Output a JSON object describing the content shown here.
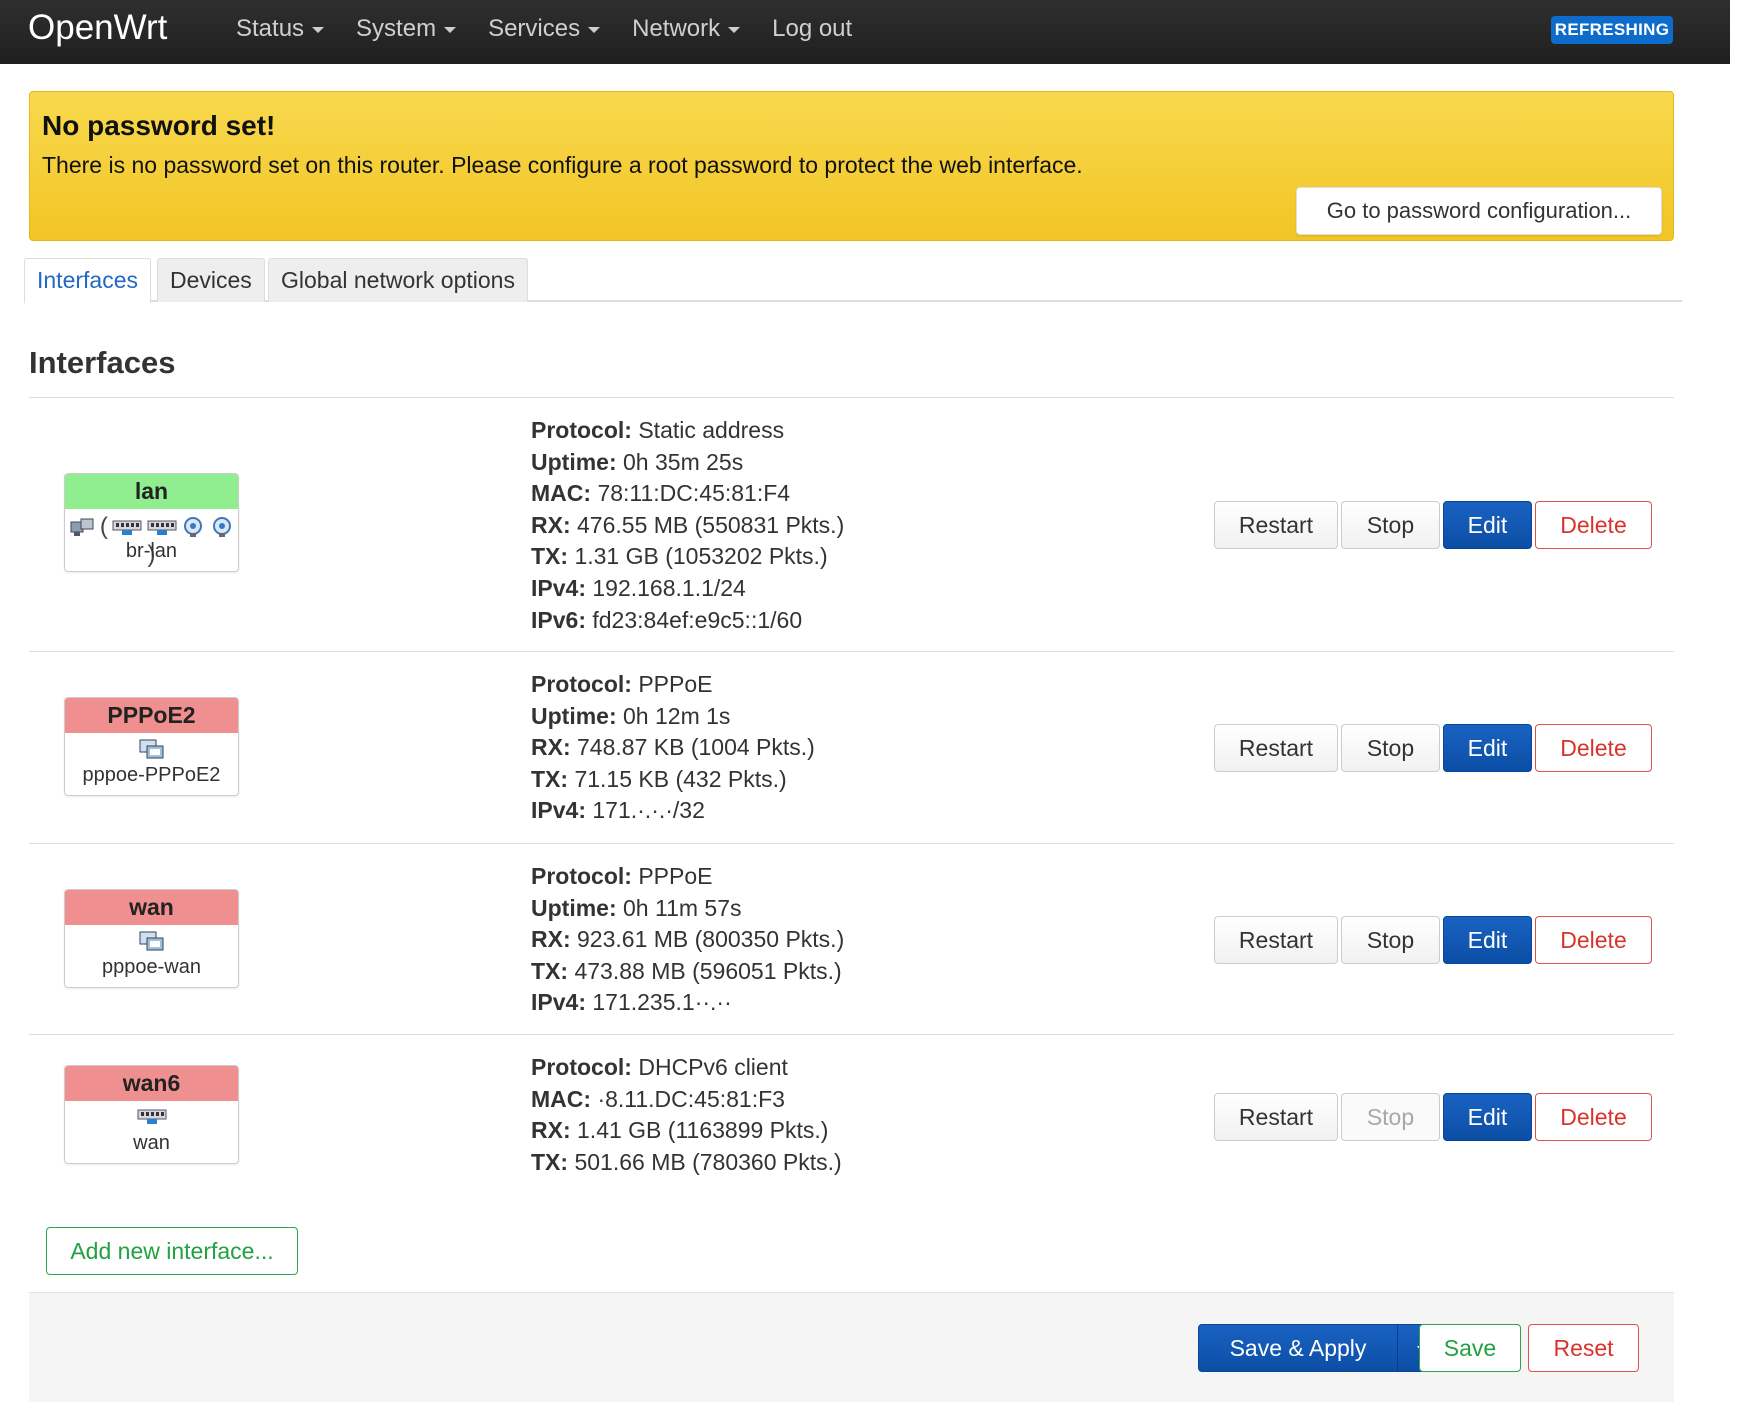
{
  "app": {
    "brand": "OpenWrt",
    "status_badge": "REFRESHING"
  },
  "nav": {
    "items": [
      {
        "label": "Status",
        "dropdown": true
      },
      {
        "label": "System",
        "dropdown": true
      },
      {
        "label": "Services",
        "dropdown": true
      },
      {
        "label": "Network",
        "dropdown": true
      },
      {
        "label": "Log out",
        "dropdown": false
      }
    ]
  },
  "alert": {
    "title": "No password set!",
    "text": "There is no password set on this router. Please configure a root password to protect the web interface.",
    "button": "Go to password configuration..."
  },
  "tabs": [
    {
      "label": "Interfaces",
      "active": true
    },
    {
      "label": "Devices",
      "active": false
    },
    {
      "label": "Global network options",
      "active": false
    }
  ],
  "section": {
    "title": "Interfaces"
  },
  "interfaces": [
    {
      "name": "lan",
      "state": "up",
      "device": "br-lan",
      "details": [
        {
          "k": "Protocol:",
          "v": "Static address"
        },
        {
          "k": "Uptime:",
          "v": "0h 35m 25s"
        },
        {
          "k": "MAC:",
          "v": "78:11:DC:45:81:F4"
        },
        {
          "k": "RX:",
          "v": "476.55 MB (550831 Pkts.)"
        },
        {
          "k": "TX:",
          "v": "1.31 GB (1053202 Pkts.)"
        },
        {
          "k": "IPv4:",
          "v": "192.168.1.1/24"
        },
        {
          "k": "IPv6:",
          "v": "fd23:84ef:e9c5::1/60"
        }
      ],
      "stop_disabled": false
    },
    {
      "name": "PPPoE2",
      "state": "down",
      "device": "pppoe-PPPoE2",
      "details": [
        {
          "k": "Protocol:",
          "v": "PPPoE"
        },
        {
          "k": "Uptime:",
          "v": "0h 12m 1s"
        },
        {
          "k": "RX:",
          "v": "748.87 KB (1004 Pkts.)"
        },
        {
          "k": "TX:",
          "v": "71.15 KB (432 Pkts.)"
        },
        {
          "k": "IPv4:",
          "v": "171.·.·.·/32"
        }
      ],
      "stop_disabled": false
    },
    {
      "name": "wan",
      "state": "down",
      "device": "pppoe-wan",
      "details": [
        {
          "k": "Protocol:",
          "v": "PPPoE"
        },
        {
          "k": "Uptime:",
          "v": "0h 11m 57s"
        },
        {
          "k": "RX:",
          "v": "923.61 MB (800350 Pkts.)"
        },
        {
          "k": "TX:",
          "v": "473.88 MB (596051 Pkts.)"
        },
        {
          "k": "IPv4:",
          "v": "171.235.1··.··"
        }
      ],
      "stop_disabled": false
    },
    {
      "name": "wan6",
      "state": "down",
      "device": "wan",
      "details": [
        {
          "k": "Protocol:",
          "v": "DHCPv6 client"
        },
        {
          "k": "MAC:",
          "v": "·8.11.DC:45:81:F3"
        },
        {
          "k": "RX:",
          "v": "1.41 GB (1163899 Pkts.)"
        },
        {
          "k": "TX:",
          "v": "501.66 MB (780360 Pkts.)"
        }
      ],
      "stop_disabled": true
    }
  ],
  "row_buttons": {
    "restart": "Restart",
    "stop": "Stop",
    "edit": "Edit",
    "delete": "Delete"
  },
  "add_interface": "Add new interface...",
  "footer": {
    "save_apply": "Save & Apply",
    "save": "Save",
    "reset": "Reset"
  },
  "colors": {
    "navbar": "#262626",
    "badge": "#0d6bcb",
    "alert": "#f2c525",
    "iface_up": "#90ee90",
    "iface_down": "#f08f8f",
    "primary": "#0b4ea5",
    "positive": "#23a042",
    "negative": "#d9342b",
    "tab_active": "#2268c4"
  },
  "icons": {
    "lan": [
      "ethernet-port-icon",
      "switch-icon",
      "switch-icon",
      "wifi-icon",
      "wifi-icon"
    ],
    "PPPoE2": [
      "tunnel-icon"
    ],
    "wan": [
      "tunnel-icon"
    ],
    "wan6": [
      "switch-icon"
    ]
  }
}
